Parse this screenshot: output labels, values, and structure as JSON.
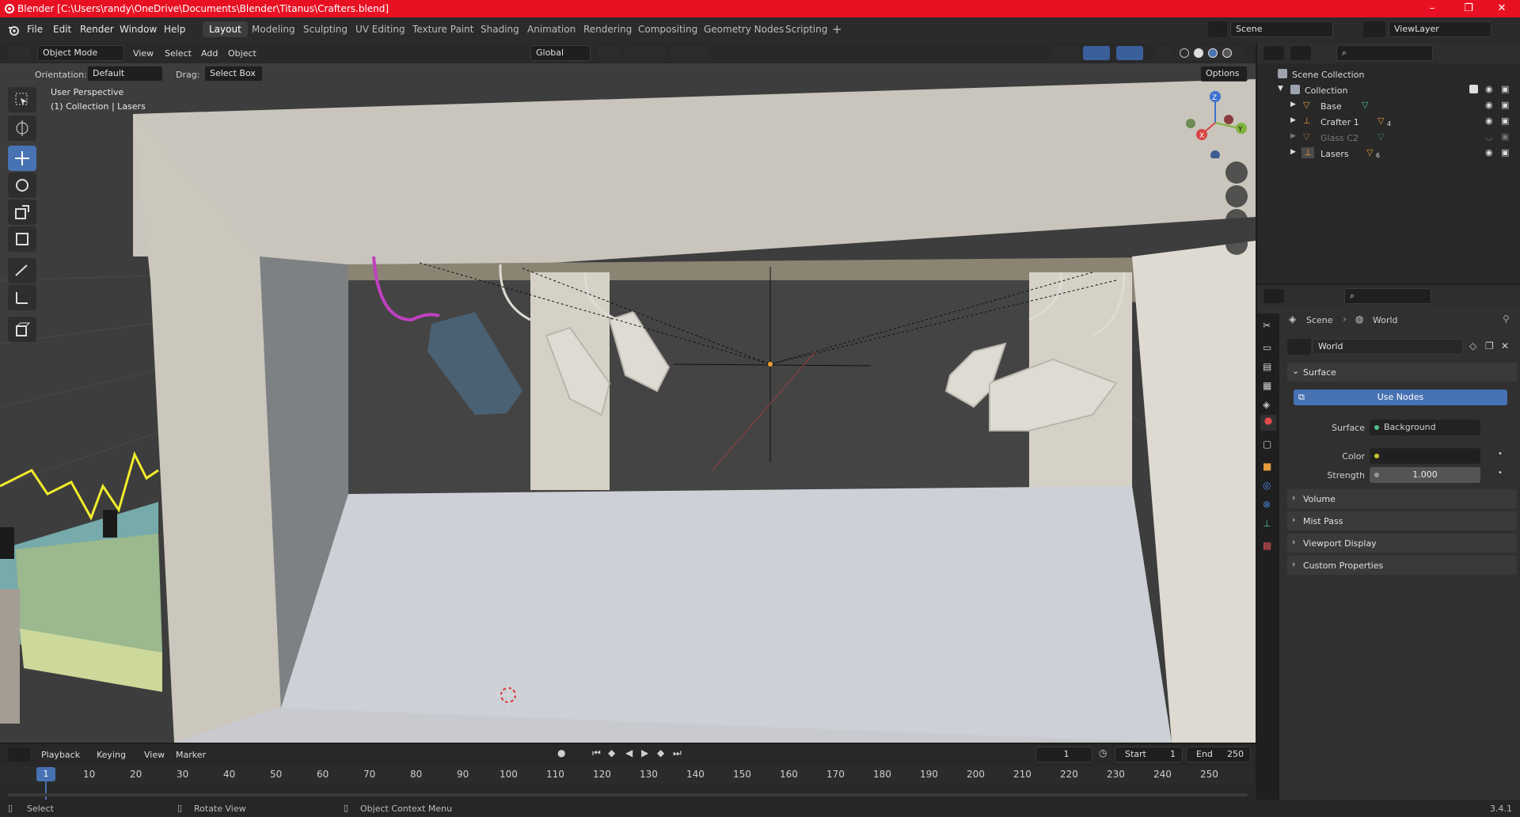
{
  "window": {
    "title": "Blender [C:\\Users\\randy\\OneDrive\\Documents\\Blender\\Titanus\\Crafters.blend]",
    "controls": [
      "–",
      "❐",
      "✕"
    ]
  },
  "menu": [
    "File",
    "Edit",
    "Render",
    "Window",
    "Help"
  ],
  "workspaces": [
    "Layout",
    "Modeling",
    "Sculpting",
    "UV Editing",
    "Texture Paint",
    "Shading",
    "Animation",
    "Rendering",
    "Compositing",
    "Geometry Nodes",
    "Scripting"
  ],
  "active_workspace": "Layout",
  "scene": "Scene",
  "view_layer": "ViewLayer",
  "viewport_header": {
    "mode": "Object Mode",
    "menus": [
      "View",
      "Select",
      "Add",
      "Object"
    ],
    "transform": "Global",
    "orientation_label": "Orientation:",
    "orientation": "Default",
    "drag_label": "Drag:",
    "drag": "Select Box",
    "options": "Options"
  },
  "viewport_overlay": {
    "perspective": "User Perspective",
    "collection": "(1) Collection | Lasers"
  },
  "gizmo": {
    "x": "X",
    "y": "Y",
    "z": "Z"
  },
  "outliner": {
    "root": "Scene Collection",
    "collection": "Collection",
    "items": [
      {
        "name": "Base",
        "subscript": ""
      },
      {
        "name": "Crafter 1",
        "subscript": "4"
      },
      {
        "name": "Glass C2",
        "subscript": ""
      },
      {
        "name": "Lasers",
        "subscript": "6"
      }
    ]
  },
  "properties": {
    "breadcrumb": [
      "Scene",
      "World"
    ],
    "world_name": "World",
    "surface_section": "Surface",
    "use_nodes": "Use Nodes",
    "surface_label": "Surface",
    "surface_value": "Background",
    "color_label": "Color",
    "strength_label": "Strength",
    "strength_value": "1.000",
    "sections": [
      "Volume",
      "Mist Pass",
      "Viewport Display",
      "Custom Properties"
    ]
  },
  "timeline": {
    "menus": [
      "Playback",
      "Keying",
      "View",
      "Marker"
    ],
    "current_frame": "1",
    "start_label": "Start",
    "start": "1",
    "end_label": "End",
    "end": "250",
    "ruler": [
      "10",
      "20",
      "30",
      "40",
      "50",
      "60",
      "70",
      "80",
      "90",
      "100",
      "110",
      "120",
      "130",
      "140",
      "150",
      "160",
      "170",
      "180",
      "190",
      "200",
      "210",
      "220",
      "230",
      "240",
      "250"
    ],
    "playhead": "1"
  },
  "status": {
    "select": "Select",
    "rotate": "Rotate View",
    "context": "Object Context Menu",
    "version": "3.4.1"
  }
}
